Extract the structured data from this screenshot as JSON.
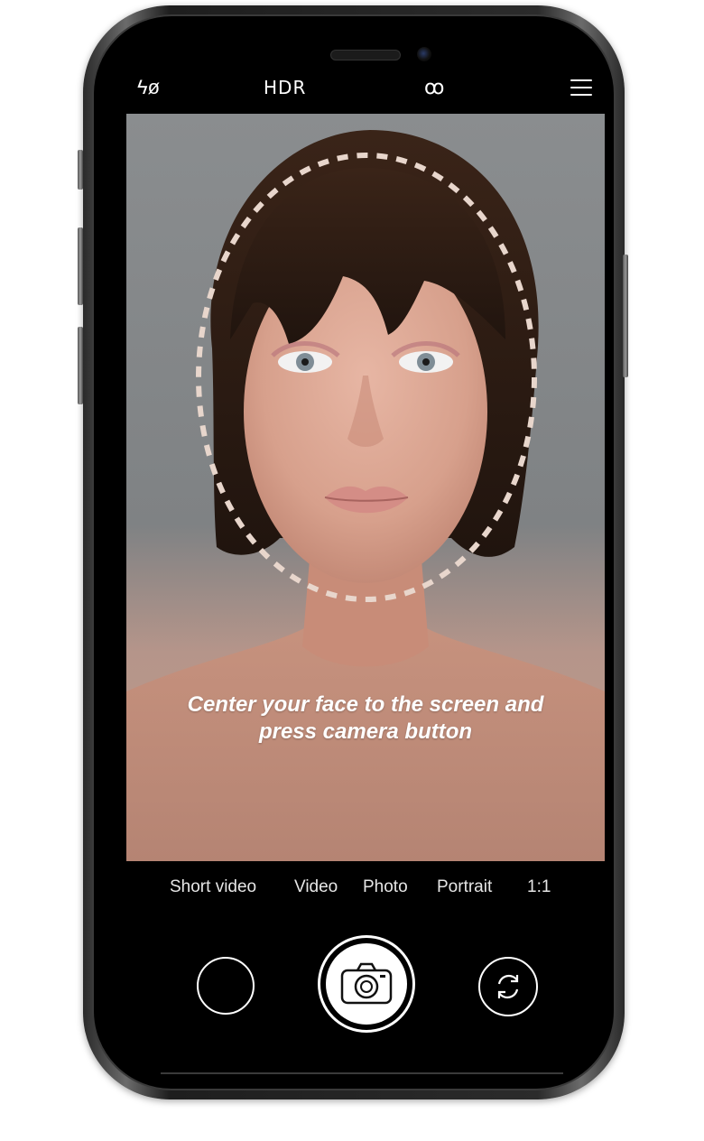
{
  "top_bar": {
    "flash_label": "ϟø",
    "hdr_label": "HDR",
    "effects_label": "ꝏ",
    "menu_icon": "hamburger-menu-icon"
  },
  "viewfinder": {
    "instruction_line1": "Center your face to the screen and",
    "instruction_line2": "press camera button",
    "face_guide": "dashed-oval"
  },
  "modes": {
    "items": [
      "Short video",
      "Video",
      "Photo",
      "Portrait",
      "1:1"
    ],
    "selected": "Photo"
  },
  "controls": {
    "gallery_icon": "gallery-thumbnail-icon",
    "shutter_icon": "camera-icon",
    "switch_icon": "switch-camera-icon"
  },
  "colors": {
    "background": "#000000",
    "text": "#ffffff",
    "guide": "#e8d6cc"
  }
}
